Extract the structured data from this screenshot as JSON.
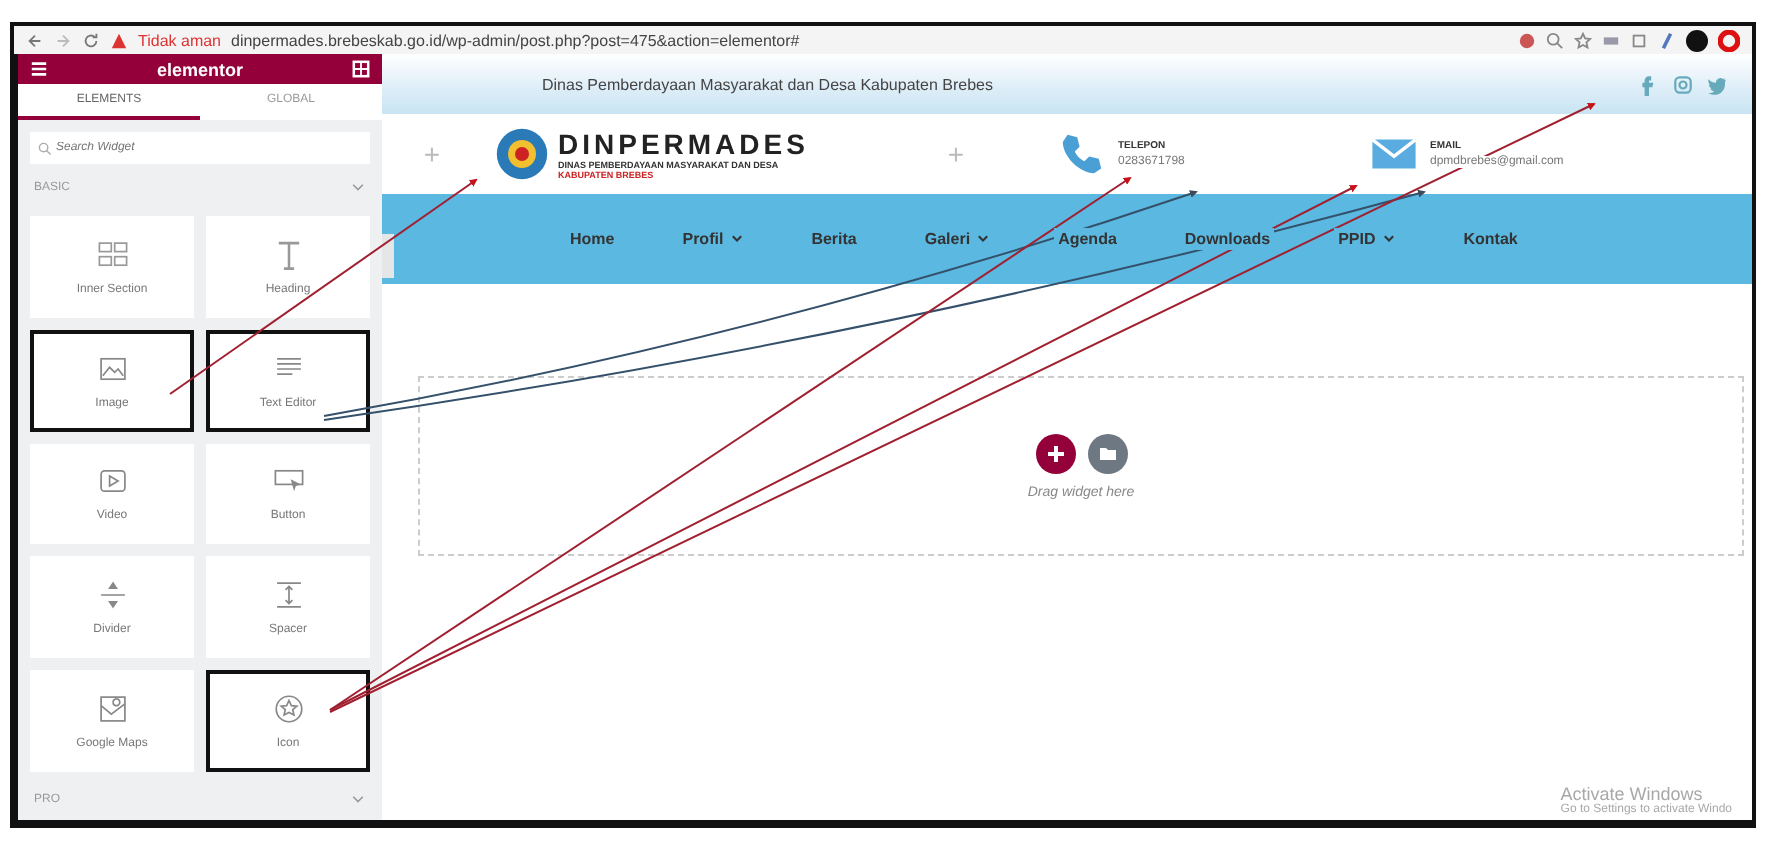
{
  "browser": {
    "security": "Tidak aman",
    "url": "dinpermades.brebeskab.go.id/wp-admin/post.php?post=475&action=elementor#"
  },
  "sidebar": {
    "brand": "elementor",
    "tabs": [
      {
        "label": "ELEMENTS",
        "selected": true
      },
      {
        "label": "GLOBAL",
        "selected": false
      }
    ],
    "search": {
      "placeholder": "Search Widget"
    },
    "category": "BASIC",
    "widgets": [
      {
        "label": "Inner Section",
        "kind": "columns",
        "highlighted": false
      },
      {
        "label": "Heading",
        "kind": "heading",
        "highlighted": false
      },
      {
        "label": "Image",
        "kind": "image",
        "highlighted": true
      },
      {
        "label": "Text Editor",
        "kind": "text",
        "highlighted": true
      },
      {
        "label": "Video",
        "kind": "video",
        "highlighted": false
      },
      {
        "label": "Button",
        "kind": "button",
        "highlighted": false
      },
      {
        "label": "Divider",
        "kind": "divider",
        "highlighted": false
      },
      {
        "label": "Spacer",
        "kind": "spacer",
        "highlighted": false
      },
      {
        "label": "Google Maps",
        "kind": "map",
        "highlighted": false
      },
      {
        "label": "Icon",
        "kind": "star",
        "highlighted": true
      }
    ],
    "next_category": "PRO"
  },
  "site": {
    "tagline": "Dinas Pemberdayaan Masyarakat dan Desa Kabupaten Brebes",
    "add_marks": [
      "+",
      "+"
    ],
    "logo": {
      "name": "DINPERMADES",
      "line1": "DINAS PEMBERDAYAAN MASYARAKAT DAN DESA",
      "line2": "KABUPATEN BREBES"
    },
    "contacts": [
      {
        "kind": "phone",
        "label": "TELEPON",
        "value": "0283671798"
      },
      {
        "kind": "email",
        "label": "EMAIL",
        "value": "dpmdbrebes@gmail.com"
      }
    ],
    "nav": [
      {
        "label": "Home",
        "dropdown": false
      },
      {
        "label": "Profil",
        "dropdown": true
      },
      {
        "label": "Berita",
        "dropdown": false
      },
      {
        "label": "Galeri",
        "dropdown": true
      },
      {
        "label": "Agenda",
        "dropdown": false
      },
      {
        "label": "Downloads",
        "dropdown": false
      },
      {
        "label": "PPID",
        "dropdown": true
      },
      {
        "label": "Kontak",
        "dropdown": false
      }
    ],
    "dropzone": {
      "hint": "Drag widget here"
    }
  },
  "os_notice": {
    "title": "Activate Windows",
    "subtitle": "Go to Settings to activate Windo"
  }
}
